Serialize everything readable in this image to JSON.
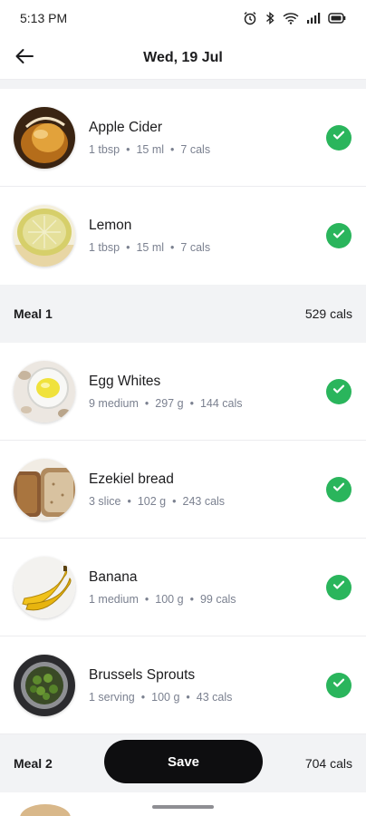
{
  "status_bar": {
    "time": "5:13 PM",
    "icons": [
      "alarm-icon",
      "bluetooth-icon",
      "wifi-icon",
      "signal-icon",
      "battery-icon"
    ]
  },
  "header": {
    "back_icon": "arrow-left-icon",
    "title": "Wed, 19 Jul"
  },
  "pre_meal_items": [
    {
      "name": "Apple Cider",
      "qty": "1 tbsp",
      "amount": "15 ml",
      "cals": "7 cals",
      "checked": true
    },
    {
      "name": "Lemon",
      "qty": "1 tbsp",
      "amount": "15 ml",
      "cals": "7 cals",
      "checked": true
    }
  ],
  "meal1": {
    "name": "Meal 1",
    "cals": "529 cals",
    "items": [
      {
        "name": "Egg Whites",
        "qty": "9 medium",
        "amount": "297 g",
        "cals": "144 cals",
        "checked": true
      },
      {
        "name": "Ezekiel bread",
        "qty": "3 slice",
        "amount": "102 g",
        "cals": "243 cals",
        "checked": true
      },
      {
        "name": "Banana",
        "qty": "1 medium",
        "amount": "100 g",
        "cals": "99 cals",
        "checked": true
      },
      {
        "name": "Brussels Sprouts",
        "qty": "1 serving",
        "amount": "100 g",
        "cals": "43 cals",
        "checked": true
      }
    ]
  },
  "meal2": {
    "name": "Meal 2",
    "cals": "704 cals"
  },
  "save_button": {
    "label": "Save"
  },
  "colors": {
    "check_green": "#2ab55c",
    "section_bg": "#f2f3f5",
    "meta_text": "#7b8190",
    "button_bg": "#0e0e10"
  }
}
